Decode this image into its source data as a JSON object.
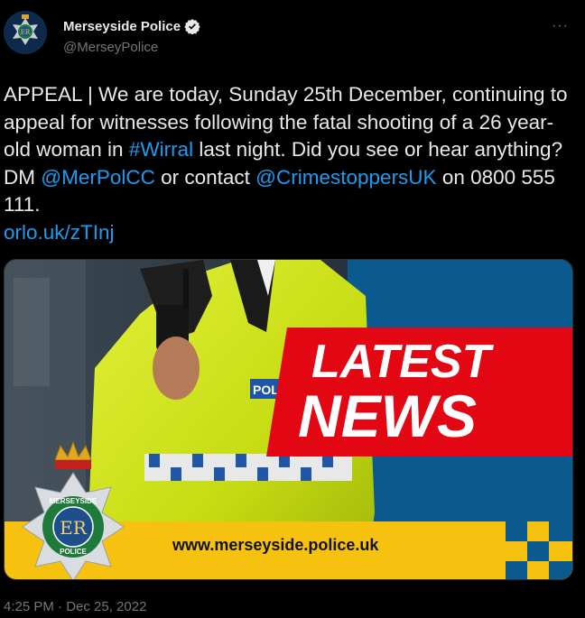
{
  "account": {
    "name": "Merseyside Police",
    "handle": "@MerseyPolice",
    "verified": true,
    "avatar_icon": "police-crest-icon"
  },
  "more_label": "···",
  "tweet": {
    "lead": "APPEAL | We are today, Sunday 25th December, continuing to appeal for witnesses following the fatal shooting of a 26 year-old woman in ",
    "hashtag": "#Wirral",
    "mid": " last night. Did you see or hear anything? DM  ",
    "mention1": "@MerPolCC",
    "mid2": " or contact ",
    "mention2": "@CrimestoppersUK",
    "tail": " on 0800 555 111.",
    "url": "orlo.uk/zTInj"
  },
  "media": {
    "headline_line1": "LATEST",
    "headline_line2": "NEWS",
    "website": "www.merseyside.police.uk",
    "badge_text_top": "MERSEYSIDE",
    "badge_text_bottom": "POLICE",
    "badge_monogram": "ER",
    "vest_badge": "POL",
    "colors": {
      "red": "#e30613",
      "yellow": "#f7c10f",
      "blue": "#0a5a8f",
      "hivis": "#d4ea1a"
    }
  },
  "timestamp": "4:25 PM · Dec 25, 2022"
}
